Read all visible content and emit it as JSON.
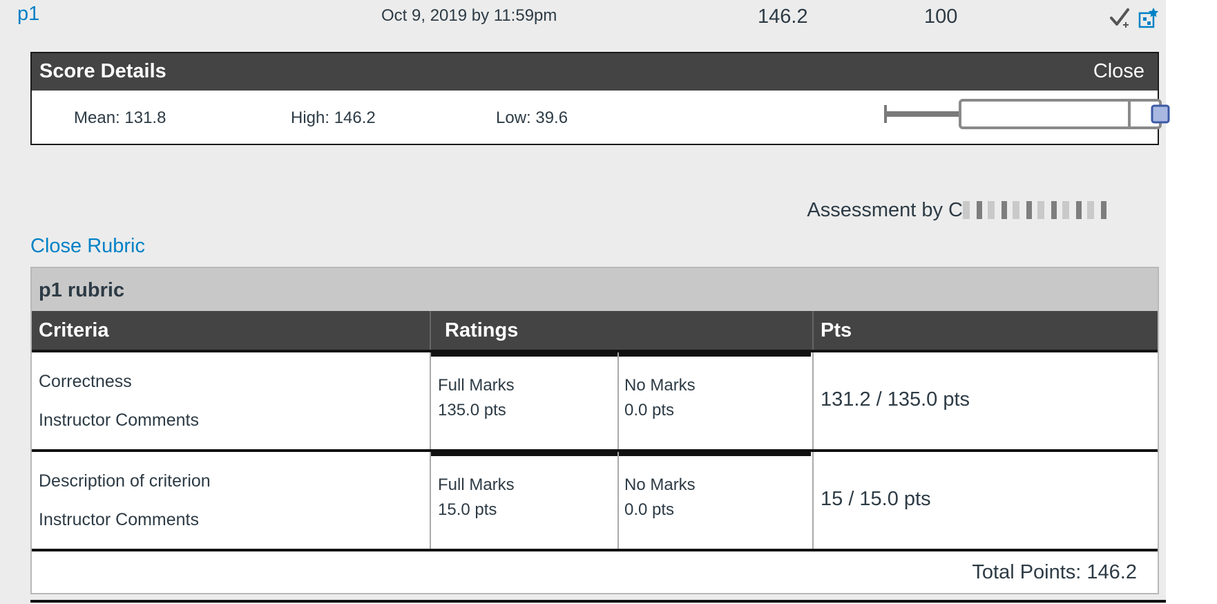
{
  "grade_row": {
    "assignment": "p1",
    "due": "Oct 9, 2019 by 11:59pm",
    "score": "146.2",
    "points_possible": "100"
  },
  "score_details": {
    "title": "Score Details",
    "close_label": "Close",
    "mean": "Mean: 131.8",
    "high": "High: 146.2",
    "low": "Low: 39.6"
  },
  "assessment": {
    "prefix": "Assessment by C"
  },
  "close_rubric_label": "Close Rubric",
  "rubric": {
    "title": "p1 rubric",
    "headers": {
      "criteria": "Criteria",
      "ratings": "Ratings",
      "pts": "Pts"
    },
    "rows": [
      {
        "criterion": "Correctness",
        "comments": "Instructor Comments",
        "ratings": [
          {
            "label": "Full Marks",
            "pts": "135.0 pts"
          },
          {
            "label": "No Marks",
            "pts": "0.0 pts"
          }
        ],
        "points": "131.2 / 135.0 pts"
      },
      {
        "criterion": "Description of criterion",
        "comments": "Instructor Comments",
        "ratings": [
          {
            "label": "Full Marks",
            "pts": "15.0 pts"
          },
          {
            "label": "No Marks",
            "pts": "0.0 pts"
          }
        ],
        "points": "15 / 15.0 pts"
      }
    ],
    "total": "Total Points: 146.2"
  },
  "colors": {
    "link": "#0081c6",
    "header_bg": "#444444",
    "panel_bg": "#ececec",
    "title_bar_bg": "#c8c8c8",
    "boxplot_marker": "#a9b8e0"
  },
  "icons": [
    "checkmark-plus-icon",
    "what-if-star-icon"
  ]
}
